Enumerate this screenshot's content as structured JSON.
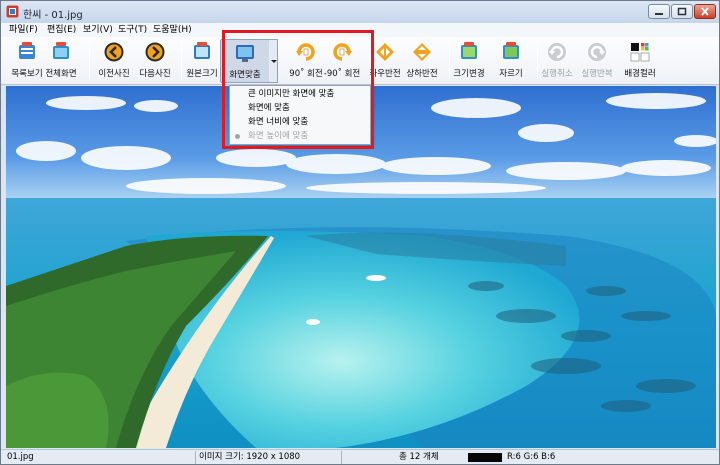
{
  "window": {
    "title": "한씨 - 01.jpg"
  },
  "menu": [
    "파일(F)",
    "편집(E)",
    "보기(V)",
    "도구(T)",
    "도움말(H)"
  ],
  "toolbar": {
    "buttons": [
      {
        "label": "목록보기",
        "icon": "list-view-icon"
      },
      {
        "label": "전체화면",
        "icon": "fullscreen-icon"
      },
      {
        "label": "이전사진",
        "icon": "previous-icon"
      },
      {
        "label": "다음사진",
        "icon": "next-icon"
      },
      {
        "label": "원본크기",
        "icon": "original-size-icon"
      },
      {
        "label": "화면맞춤",
        "icon": "fit-screen-icon"
      },
      {
        "label": "90˚ 회전",
        "icon": "rotate-cw-icon"
      },
      {
        "label": "-90˚ 회전",
        "icon": "rotate-ccw-icon"
      },
      {
        "label": "좌우반전",
        "icon": "flip-horizontal-icon"
      },
      {
        "label": "상하반전",
        "icon": "flip-vertical-icon"
      },
      {
        "label": "크기변경",
        "icon": "resize-icon"
      },
      {
        "label": "자르기",
        "icon": "crop-icon"
      },
      {
        "label": "실행취소",
        "icon": "undo-icon"
      },
      {
        "label": "실행반복",
        "icon": "redo-icon"
      },
      {
        "label": "배경컬러",
        "icon": "background-color-icon"
      }
    ]
  },
  "fit_menu": {
    "items": [
      {
        "label": "큰 이미지만 화면에 맞춤",
        "enabled": true,
        "checked": false
      },
      {
        "label": "화면에 맞춤",
        "enabled": true,
        "checked": false
      },
      {
        "label": "화면 너비에 맞춤",
        "enabled": true,
        "checked": false
      },
      {
        "label": "화면 높이에 맞춤",
        "enabled": false,
        "checked": true
      }
    ]
  },
  "status": {
    "filename": "01.jpg",
    "image_size": "이미지 크기: 1920 x 1080",
    "count": "총 12 개체",
    "pixel_color": "#060606",
    "rgb": "R:6 G:6 B:6"
  },
  "colors": {
    "highlight": "#e21a1f",
    "toolbar_bg": "#eef2f7"
  }
}
